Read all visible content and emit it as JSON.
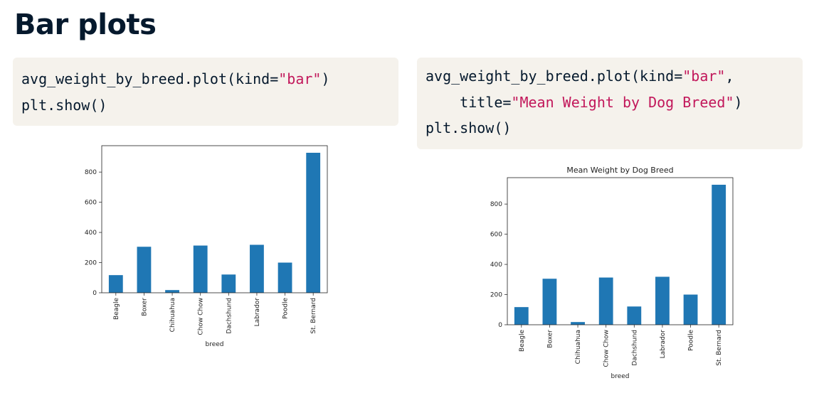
{
  "page": {
    "title": "Bar plots"
  },
  "code_blocks": [
    {
      "lines": [
        [
          {
            "t": "avg_weight_by_breed.plot(kind=",
            "s": false
          },
          {
            "t": "\"bar\"",
            "s": true
          },
          {
            "t": ")",
            "s": false
          }
        ],
        [
          {
            "t": "plt.show()",
            "s": false
          }
        ]
      ]
    },
    {
      "lines": [
        [
          {
            "t": "avg_weight_by_breed.plot(kind=",
            "s": false
          },
          {
            "t": "\"bar\"",
            "s": true
          },
          {
            "t": ",",
            "s": false
          }
        ],
        [
          {
            "t": "    title=",
            "s": false
          },
          {
            "t": "\"Mean Weight by Dog Breed\"",
            "s": true
          },
          {
            "t": ")",
            "s": false
          }
        ],
        [
          {
            "t": "plt.show()",
            "s": false
          }
        ]
      ]
    }
  ],
  "colors": {
    "bar": "#1f77b4",
    "string_literal": "#c2185b",
    "code_background": "#f5f2ec"
  },
  "chart_data": [
    {
      "type": "bar",
      "title": "",
      "xlabel": "breed",
      "ylabel": "",
      "categories": [
        "Beagle",
        "Boxer",
        "Chihuahua",
        "Chow Chow",
        "Dachshund",
        "Labrador",
        "Poodle",
        "St. Bernard"
      ],
      "values": [
        117,
        305,
        18,
        313,
        121,
        318,
        200,
        928
      ],
      "yticks": [
        0,
        200,
        400,
        600,
        800
      ],
      "ylim": [
        0,
        975
      ],
      "grid": false,
      "legend": false
    },
    {
      "type": "bar",
      "title": "Mean Weight by Dog Breed",
      "xlabel": "breed",
      "ylabel": "",
      "categories": [
        "Beagle",
        "Boxer",
        "Chihuahua",
        "Chow Chow",
        "Dachshund",
        "Labrador",
        "Poodle",
        "St. Bernard"
      ],
      "values": [
        117,
        305,
        18,
        313,
        121,
        318,
        200,
        928
      ],
      "yticks": [
        0,
        200,
        400,
        600,
        800
      ],
      "ylim": [
        0,
        975
      ],
      "grid": false,
      "legend": false
    }
  ]
}
